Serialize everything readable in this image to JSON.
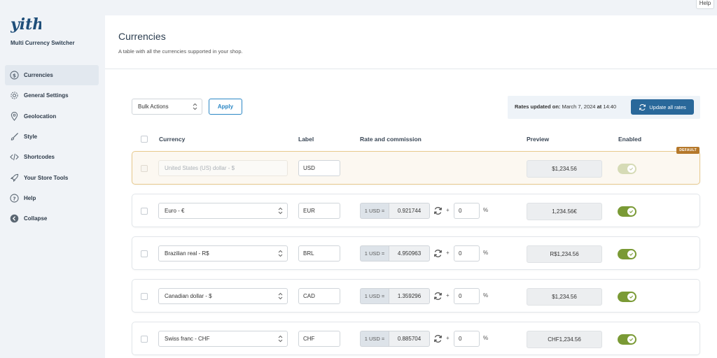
{
  "help_tab": "Help",
  "brand": {
    "logo_text": "yith",
    "plugin_name": "Multi Currency Switcher"
  },
  "sidebar": {
    "items": [
      {
        "label": "Currencies",
        "icon": "dollar-icon",
        "active": true
      },
      {
        "label": "General Settings",
        "icon": "gear-icon",
        "active": false
      },
      {
        "label": "Geolocation",
        "icon": "map-pin-icon",
        "active": false
      },
      {
        "label": "Style",
        "icon": "brush-icon",
        "active": false
      },
      {
        "label": "Shortcodes",
        "icon": "code-icon",
        "active": false
      },
      {
        "label": "Your Store Tools",
        "icon": "rocket-icon",
        "active": false
      },
      {
        "label": "Help",
        "icon": "question-icon",
        "active": false
      },
      {
        "label": "Collapse",
        "icon": "collapse-icon",
        "active": false
      }
    ]
  },
  "page": {
    "title": "Currencies",
    "description": "A table with all the currencies supported in your shop."
  },
  "toolbar": {
    "bulk_actions": "Bulk Actions",
    "apply": "Apply",
    "rates_label": "Rates updated on:",
    "rates_date": "March 7, 2024",
    "rates_at": "at",
    "rates_time": "14:40",
    "update_all": "Update all rates"
  },
  "table": {
    "headers": {
      "currency": "Currency",
      "label": "Label",
      "rate": "Rate and commission",
      "preview": "Preview",
      "enabled": "Enabled"
    },
    "default_badge": "DEFAULT",
    "rate_prefix": "1 USD =",
    "plus": "+",
    "percent": "%",
    "rows": [
      {
        "currency": "United States (US) dollar - $",
        "label": "USD",
        "rate": "",
        "commission": "",
        "preview": "$1,234.56",
        "enabled": true,
        "is_default": true
      },
      {
        "currency": "Euro - €",
        "label": "EUR",
        "rate": "0.921744",
        "commission": "0",
        "preview": "1,234.56€",
        "enabled": true,
        "is_default": false
      },
      {
        "currency": "Brazilian real - R$",
        "label": "BRL",
        "rate": "4.950963",
        "commission": "0",
        "preview": "R$1,234.56",
        "enabled": true,
        "is_default": false
      },
      {
        "currency": "Canadian dollar - $",
        "label": "CAD",
        "rate": "1.359296",
        "commission": "0",
        "preview": "$1,234.56",
        "enabled": true,
        "is_default": false
      },
      {
        "currency": "Swiss franc - CHF",
        "label": "CHF",
        "rate": "0.885704",
        "commission": "0",
        "preview": "CHF1,234.56",
        "enabled": true,
        "is_default": false
      }
    ]
  },
  "colors": {
    "accent": "#2b87c5",
    "update_button": "#29689a",
    "toggle_on": "#7a9a35",
    "default_badge": "#b5782a",
    "default_row_border": "#e7c98d"
  }
}
